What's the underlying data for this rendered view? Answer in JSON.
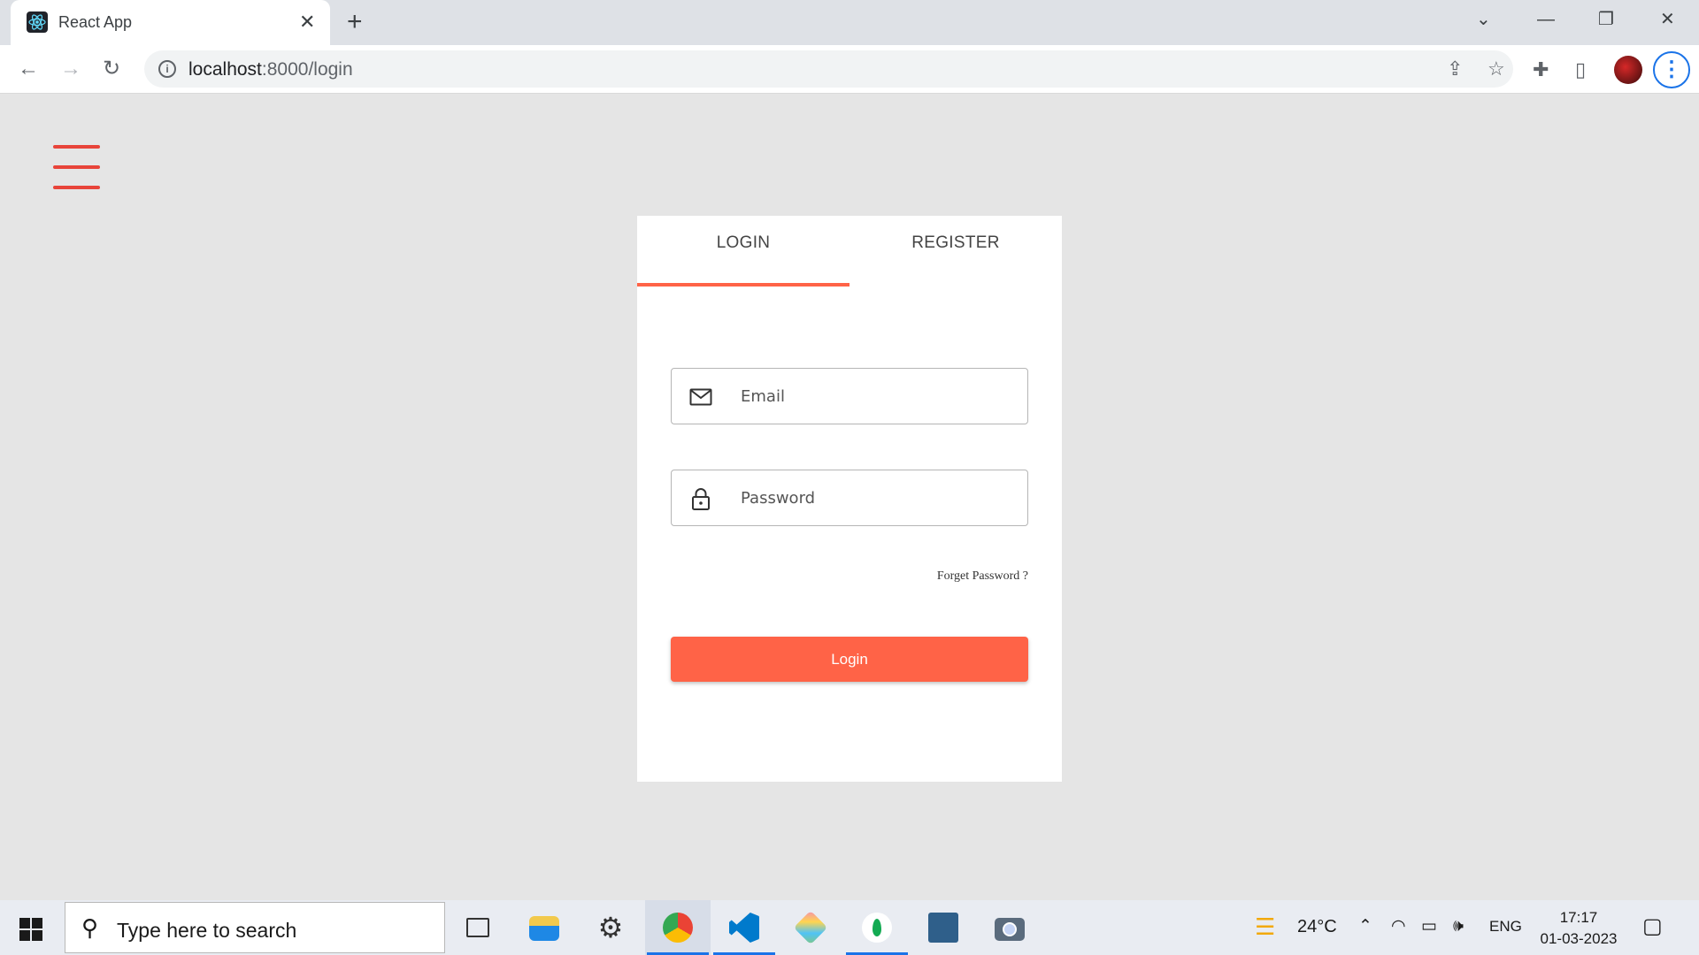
{
  "browser": {
    "tab_title": "React App",
    "tab_close": "✕",
    "new_tab": "+",
    "url_host": "localhost",
    "url_rest": ":8000/login",
    "window_controls": {
      "dropdown": "⌄",
      "minimize": "—",
      "restore": "❐",
      "close": "✕"
    },
    "nav": {
      "back": "←",
      "forward": "→",
      "reload": "↻"
    },
    "toolbar_icons": {
      "share": "⇪",
      "bookmark": "☆",
      "extensions": "✚",
      "sidepanel": "▯",
      "menu": "⋮"
    }
  },
  "page": {
    "tabs": [
      {
        "label": "LOGIN",
        "active": true
      },
      {
        "label": "REGISTER",
        "active": false
      }
    ],
    "email_placeholder": "Email",
    "password_placeholder": "Password",
    "forgot_label": "Forget Password ?",
    "login_label": "Login",
    "accent_color": "#ff6347",
    "hamburger_color": "#e8443a"
  },
  "taskbar": {
    "search_placeholder": "Type here to search",
    "apps": [
      "task-view",
      "file-explorer",
      "settings",
      "chrome",
      "vscode",
      "git",
      "mongodb",
      "mysql-workbench",
      "camera"
    ],
    "weather": "24°C",
    "language": "ENG",
    "time": "17:17",
    "date": "01-03-2023"
  }
}
